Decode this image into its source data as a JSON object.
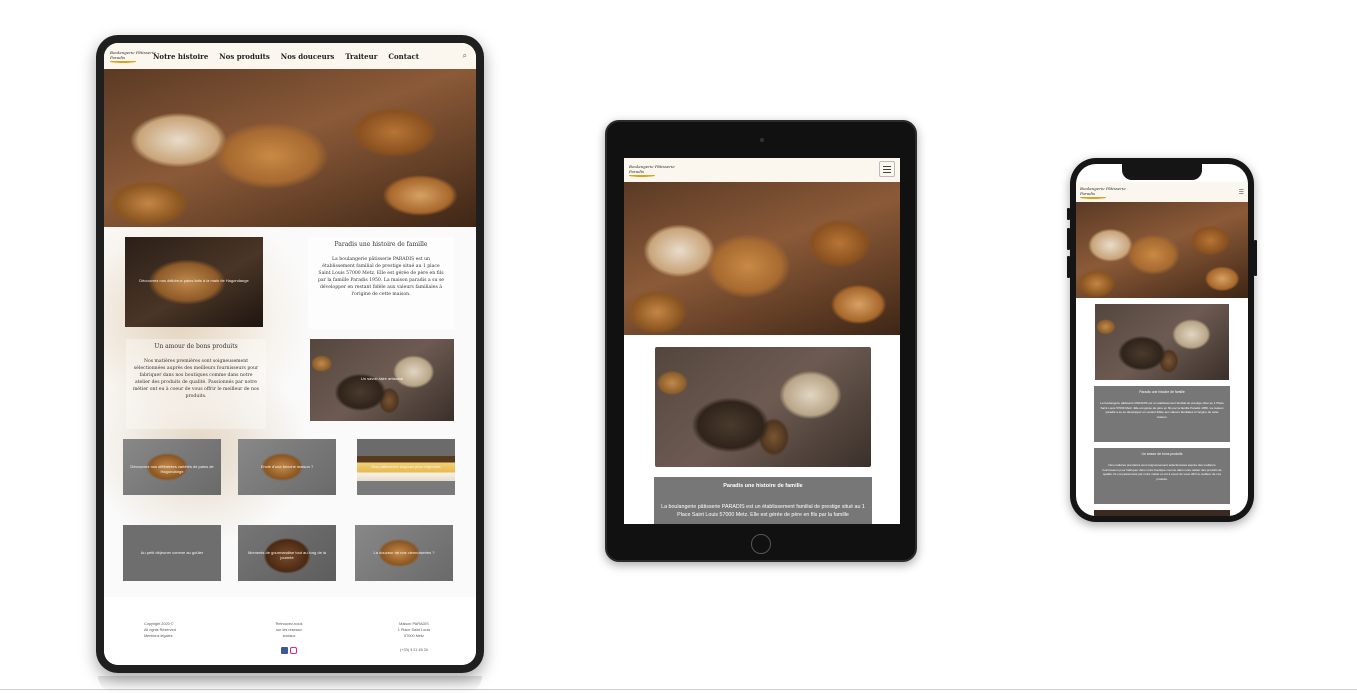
{
  "brand": {
    "logo_line1": "Boulangerie Pâtisserie",
    "logo_line2": "Paradis"
  },
  "desktop": {
    "nav": [
      "Notre histoire",
      "Nos produits",
      "Nos douceurs",
      "Traiteur",
      "Contact"
    ],
    "search_icon": "search-icon",
    "intro_caption": "Découvrez nos délicieux pains faits à la main de Hagondange",
    "history_title": "Paradis une histoire de famille",
    "history_text": "La boulangerie pâtisserie PARADIS est un établissement familial de prestige situé au 1 place Saint Louis 57000 Metz. Elle est gérée de père en fils par la famille Paradis 1950. La maison paradis a su se développer en restant fidèle aux valeurs familiales à l'origine de cette maison.",
    "love_title": "Un amour de bons produits",
    "love_text": "Nos matières premières sont soigneusement sélectionnées auprès des meilleurs fournisseurs pour fabriquer dans nos boutiques comme dans notre atelier des produits de qualité. Passionnés par notre métier ont eu à coeur de vous offrir le meilleur de nos produits.",
    "bread_caption": "Un savoir-faire artisanal",
    "tiles": [
      "Découvrez nos différentes variétés de pains de Hagondange",
      "Envie d'une brioche maison ?",
      "Nos pâtisseries toujours plus originales",
      "Au petit déjeuner comme au goûter",
      "Moments de gourmandise tout au long de la journée",
      "La douceur de nos viennoiseries ?"
    ],
    "footer": {
      "left": [
        "Copyright 2020 ©",
        "All rights Reserved",
        "Mentions légales"
      ],
      "middle": [
        "Retrouvez-nous",
        "sur les réseaux",
        "sociaux"
      ],
      "right": [
        "Maison PARADIS",
        "1 Place Saint Louis",
        "57000 Metz",
        "(+33) 3 21 45 20"
      ]
    }
  },
  "tablet": {
    "history_title": "Paradis une histoire de famille",
    "history_text": "La boulangerie pâtisserie PARADIS est un établissement familial de prestige situé au 1 Place Saint Louis 57000 Metz. Elle est gérée de père en fils par la famille"
  },
  "phone": {
    "history_title": "Paradis une histoire de famille",
    "history_text": "La boulangerie pâtisserie PARADIS est un établissement familial de prestige situé au 1 Place Saint Louis 57000 Metz. Elle est gérée de père en fils par la famille Paradis 1950. La maison paradis a su se développer en restant fidèle aux valeurs familiales à l'origine de cette maison.",
    "love_title": "Un amour de bons produits",
    "love_text": "Nos matières premières sont soigneusement sélectionnées auprès des meilleurs fournisseurs pour fabriquer dans notre boutique comme dans notre atelier des produits de qualité. Ils ont passionnés par notre métier et ont à coeur de vous offrir le meilleur de nos produits."
  },
  "colors": {
    "nav_bg": "#fbf7ee",
    "card_grey": "#777777",
    "logo_gold": "#d9a520",
    "device_frame": "#1f1f1f"
  }
}
